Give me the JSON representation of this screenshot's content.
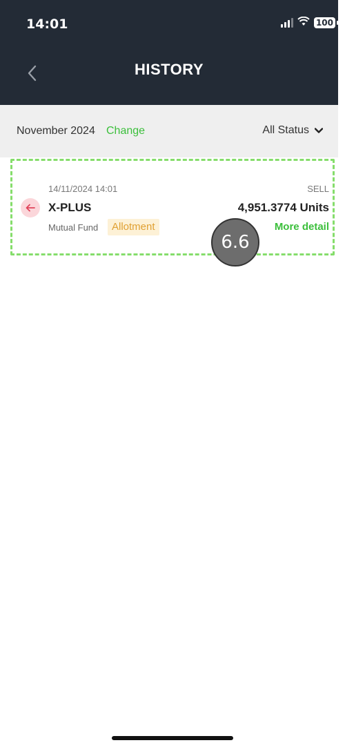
{
  "status_bar": {
    "time": "14:01",
    "battery": "100",
    "wifi_icon": "wifi-icon",
    "signal_icon": "signal-icon"
  },
  "header": {
    "title": "HISTORY",
    "back_icon": "chevron-left-icon",
    "background": "#232b36"
  },
  "filter": {
    "month": "November 2024",
    "change_label": "Change",
    "status_label": "All Status",
    "accent": "#3bbf3b"
  },
  "transactions": [
    {
      "date": "14/11/2024 14:01",
      "type": "SELL",
      "fund_name": "X-PLUS",
      "units": "4,951.3774 Units",
      "category": "Mutual Fund",
      "badge": "Allotment",
      "more_label": "More detail",
      "direction_icon": "arrow-left-icon"
    }
  ],
  "annotation": {
    "step": "6.6"
  }
}
